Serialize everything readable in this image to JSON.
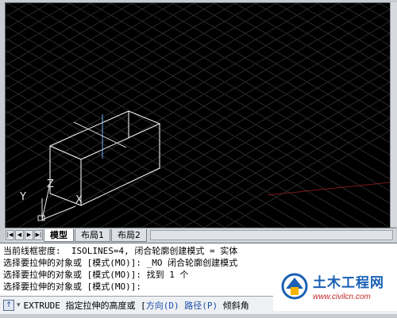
{
  "viewport": {
    "background": "#000000",
    "grid_color": "#2a2a2a",
    "model_color": "#ffffff",
    "ucs_icon": {
      "x_label": "X",
      "y_label": "Y",
      "z_label": "Z"
    }
  },
  "tabs": {
    "nav_buttons": [
      "|◀",
      "◀",
      "▶",
      "▶|"
    ],
    "items": [
      {
        "label": "模型",
        "active": true
      },
      {
        "label": "布局1",
        "active": false
      },
      {
        "label": "布局2",
        "active": false
      }
    ]
  },
  "command_history": [
    "当前线框密度:  ISOLINES=4, 闭合轮廓创建模式 = 实体",
    "选择要拉伸的对象或 [模式(MO)]: _MO 闭合轮廓创建模式",
    "选择要拉伸的对象或 [模式(MO)]: 找到 1 个",
    "选择要拉伸的对象或 [模式(MO)]:"
  ],
  "prompt": {
    "icon": "command-icon",
    "command": "EXTRUDE",
    "text": " 指定拉伸的高度或 [",
    "option1": "方向(D)",
    "sep": " ",
    "option2": "路径(P)",
    "tail": " 倾斜角"
  },
  "watermark": {
    "title": "土木工程网",
    "url": "www.civilcn.com"
  }
}
